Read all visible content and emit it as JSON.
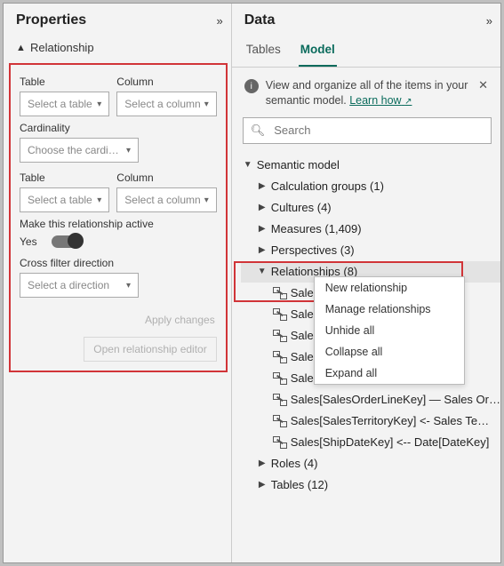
{
  "leftPanel": {
    "title": "Properties",
    "section": "Relationship",
    "table1_label": "Table",
    "column1_label": "Column",
    "table_placeholder": "Select a table",
    "column_placeholder": "Select a column",
    "cardinality_label": "Cardinality",
    "cardinality_placeholder": "Choose the cardin…",
    "table2_label": "Table",
    "column2_label": "Column",
    "active_label": "Make this relationship active",
    "active_value": "Yes",
    "crossfilter_label": "Cross filter direction",
    "crossfilter_placeholder": "Select a direction",
    "apply_btn": "Apply changes",
    "editor_btn": "Open relationship editor"
  },
  "rightPanel": {
    "title": "Data",
    "tabs": {
      "tables": "Tables",
      "model": "Model"
    },
    "info_text": "View and organize all of the items in your semantic model. ",
    "learn_text": "Learn how",
    "search_placeholder": "Search",
    "tree": {
      "root": "Semantic model",
      "calc": "Calculation groups (1)",
      "cultures": "Cultures (4)",
      "measures": "Measures (1,409)",
      "perspectives": "Perspectives (3)",
      "relationships": "Relationships (8)",
      "rels": [
        "Sales[C",
        "Sales[D",
        "Sales[C",
        "Sales[P",
        "Sales[R",
        "Sales[SalesOrderLineKey] — Sales Or…",
        "Sales[SalesTerritoryKey] <- Sales Te…",
        "Sales[ShipDateKey] <-- Date[DateKey]"
      ],
      "roles": "Roles (4)",
      "tables": "Tables (12)"
    },
    "ctx": {
      "new": "New relationship",
      "manage": "Manage relationships",
      "unhide": "Unhide all",
      "collapse": "Collapse all",
      "expand": "Expand all"
    }
  }
}
